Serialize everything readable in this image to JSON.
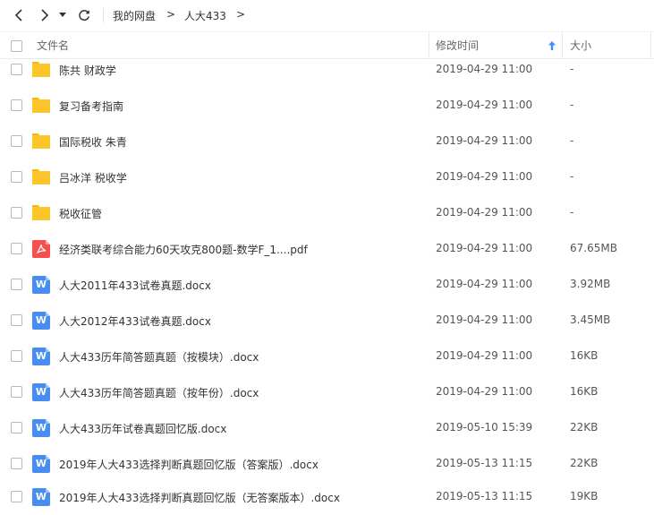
{
  "toolbar": {
    "breadcrumbs": [
      "我的网盘",
      "人大433"
    ],
    "separator": ">"
  },
  "columns": {
    "name": "文件名",
    "modified": "修改时间",
    "size": "大小",
    "sort_indicator": "arrow-up-icon"
  },
  "colors": {
    "folder": "#fcc62b",
    "word": "#4a8df0",
    "pdf": "#f3504f",
    "sort_arrow": "#3b8cff"
  },
  "files": [
    {
      "type": "folder",
      "icon": "folder-icon",
      "name": "陈共 财政学",
      "modified": "2019-04-29 11:00",
      "size": "-"
    },
    {
      "type": "folder",
      "icon": "folder-icon",
      "name": "复习备考指南",
      "modified": "2019-04-29 11:00",
      "size": "-"
    },
    {
      "type": "folder",
      "icon": "folder-icon",
      "name": "国际税收 朱青",
      "modified": "2019-04-29 11:00",
      "size": "-"
    },
    {
      "type": "folder",
      "icon": "folder-icon",
      "name": "吕冰洋 税收学",
      "modified": "2019-04-29 11:00",
      "size": "-"
    },
    {
      "type": "folder",
      "icon": "folder-icon",
      "name": "税收征管",
      "modified": "2019-04-29 11:00",
      "size": "-"
    },
    {
      "type": "pdf",
      "icon": "pdf-file-icon",
      "name": "经济类联考综合能力60天攻克800题-数学F_1....pdf",
      "modified": "2019-04-29 11:00",
      "size": "67.65MB"
    },
    {
      "type": "word",
      "icon": "word-file-icon",
      "name": "人大2011年433试卷真题.docx",
      "modified": "2019-04-29 11:00",
      "size": "3.92MB"
    },
    {
      "type": "word",
      "icon": "word-file-icon",
      "name": "人大2012年433试卷真题.docx",
      "modified": "2019-04-29 11:00",
      "size": "3.45MB"
    },
    {
      "type": "word",
      "icon": "word-file-icon",
      "name": "人大433历年简答题真题（按模块）.docx",
      "modified": "2019-04-29 11:00",
      "size": "16KB"
    },
    {
      "type": "word",
      "icon": "word-file-icon",
      "name": "人大433历年简答题真题（按年份）.docx",
      "modified": "2019-04-29 11:00",
      "size": "16KB"
    },
    {
      "type": "word",
      "icon": "word-file-icon",
      "name": "人大433历年试卷真题回忆版.docx",
      "modified": "2019-05-10 15:39",
      "size": "22KB"
    },
    {
      "type": "word",
      "icon": "word-file-icon",
      "name": "2019年人大433选择判断真题回忆版（答案版）.docx",
      "modified": "2019-05-13 11:15",
      "size": "22KB"
    },
    {
      "type": "word",
      "icon": "word-file-icon",
      "name": "2019年人大433选择判断真题回忆版（无答案版本）.docx",
      "modified": "2019-05-13 11:15",
      "size": "19KB"
    }
  ]
}
